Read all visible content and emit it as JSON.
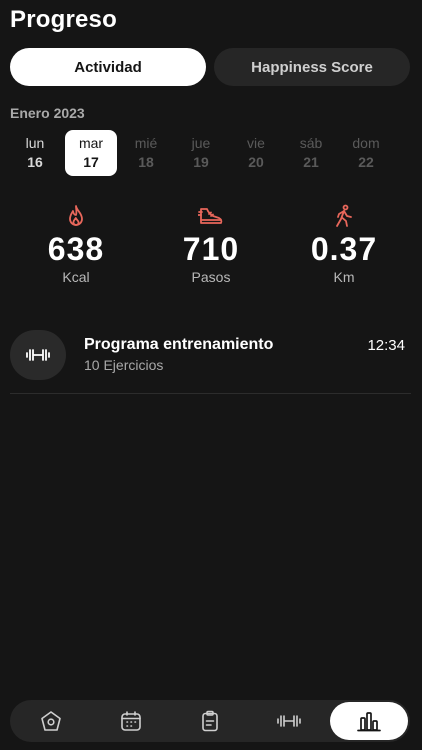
{
  "header": {
    "title": "Progreso"
  },
  "segments": {
    "active": "Actividad",
    "inactive": "Happiness Score"
  },
  "calendar": {
    "month": "Enero 2023",
    "days": [
      {
        "name": "lun",
        "num": "16"
      },
      {
        "name": "mar",
        "num": "17"
      },
      {
        "name": "mié",
        "num": "18"
      },
      {
        "name": "jue",
        "num": "19"
      },
      {
        "name": "vie",
        "num": "20"
      },
      {
        "name": "sáb",
        "num": "21"
      },
      {
        "name": "dom",
        "num": "22"
      }
    ],
    "selected_index": 1
  },
  "stats": [
    {
      "icon": "flame-icon",
      "value": "638",
      "label": "Kcal"
    },
    {
      "icon": "sneaker-icon",
      "value": "710",
      "label": "Pasos"
    },
    {
      "icon": "walking-person-icon",
      "value": "0.37",
      "label": "Km"
    }
  ],
  "program": {
    "icon": "dumbbell-icon",
    "title": "Programa entrenamiento",
    "subtitle": "10 Ejercicios",
    "time": "12:34"
  },
  "tabbar": {
    "items": [
      "home-icon",
      "calendar-icon",
      "clipboard-icon",
      "dumbbell-icon",
      "bar-chart-icon"
    ],
    "active_index": 4
  },
  "colors": {
    "accent": "#e8675b",
    "background": "#151515",
    "surface": "#262626"
  }
}
